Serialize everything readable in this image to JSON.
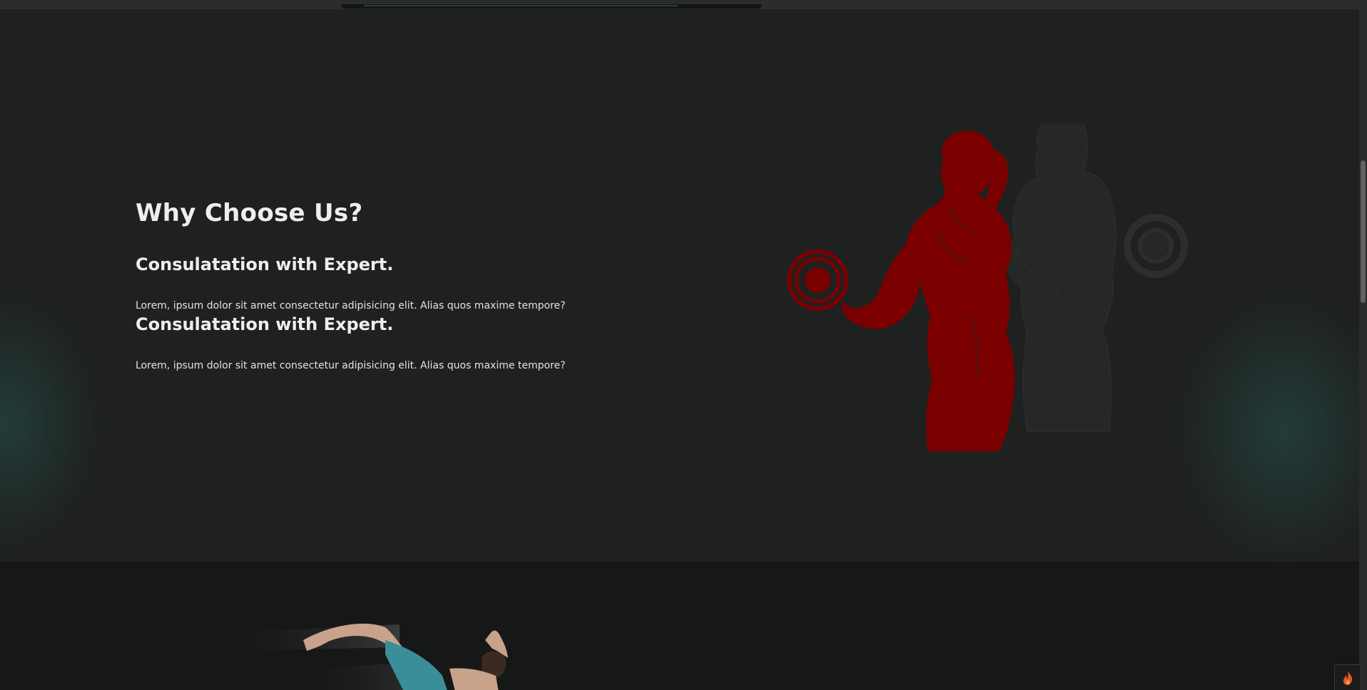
{
  "colors": {
    "page_background": "#1f2121",
    "bottom_background": "#161818",
    "heading_text": "#eeeeee",
    "body_text": "#e2e2e2",
    "accent_red": "#7a0000",
    "glow_teal": "#26524a"
  },
  "why_section": {
    "title": "Why Choose Us?",
    "features": [
      {
        "heading": "Consulatation with Expert.",
        "text": "Lorem, ipsum dolor sit amet consectetur adipisicing elit. Alias quos maxime tempore?"
      },
      {
        "heading": "Consulatation with Expert.",
        "text": "Lorem, ipsum dolor sit amet consectetur adipisicing elit. Alias quos maxime tempore?"
      }
    ],
    "image": "woman-lifting-dumbbell-silhouette"
  },
  "bottom_section": {
    "image": "athlete-jumping-photo"
  },
  "widgets": {
    "corner_icon": "flame-icon"
  }
}
